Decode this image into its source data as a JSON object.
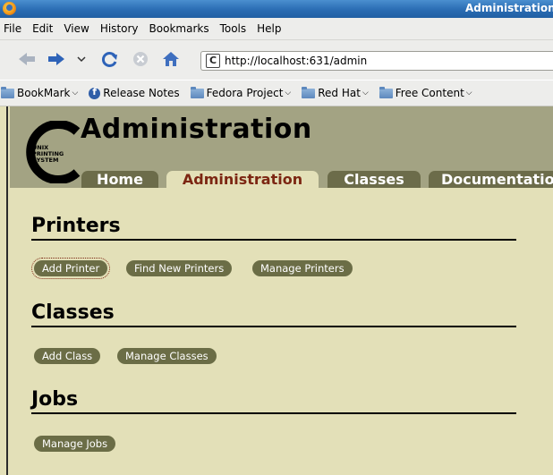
{
  "window": {
    "title": "Administration"
  },
  "menu": [
    "File",
    "Edit",
    "View",
    "History",
    "Bookmarks",
    "Tools",
    "Help"
  ],
  "navigation": {
    "url": "http://localhost:631/admin"
  },
  "bookmarks": [
    {
      "label": "BookMark",
      "icon": "folder-icon",
      "dropdown": true
    },
    {
      "label": "Release Notes",
      "icon": "fedora-icon",
      "dropdown": false
    },
    {
      "label": "Fedora Project",
      "icon": "folder-icon",
      "dropdown": true
    },
    {
      "label": "Red Hat",
      "icon": "folder-icon",
      "dropdown": true
    },
    {
      "label": "Free Content",
      "icon": "folder-icon",
      "dropdown": true
    }
  ],
  "page": {
    "logo_text": [
      "UNIX",
      "PRINTING",
      "SYSTEM"
    ],
    "title": "Administration",
    "tabs": [
      "Home",
      "Administration",
      "Classes",
      "Documentation"
    ],
    "active_tab": "Administration",
    "sections": [
      {
        "title": "Printers",
        "buttons": [
          "Add Printer",
          "Find New Printers",
          "Manage Printers"
        ]
      },
      {
        "title": "Classes",
        "buttons": [
          "Add Class",
          "Manage Classes"
        ]
      },
      {
        "title": "Jobs",
        "buttons": [
          "Manage Jobs"
        ]
      }
    ]
  },
  "colors": {
    "page_background": "#e3e0b8",
    "header_background": "#a3a383",
    "tab_background": "#6c6c4a",
    "active_tab_text": "#7c2612",
    "button_background": "#6b6d46"
  }
}
